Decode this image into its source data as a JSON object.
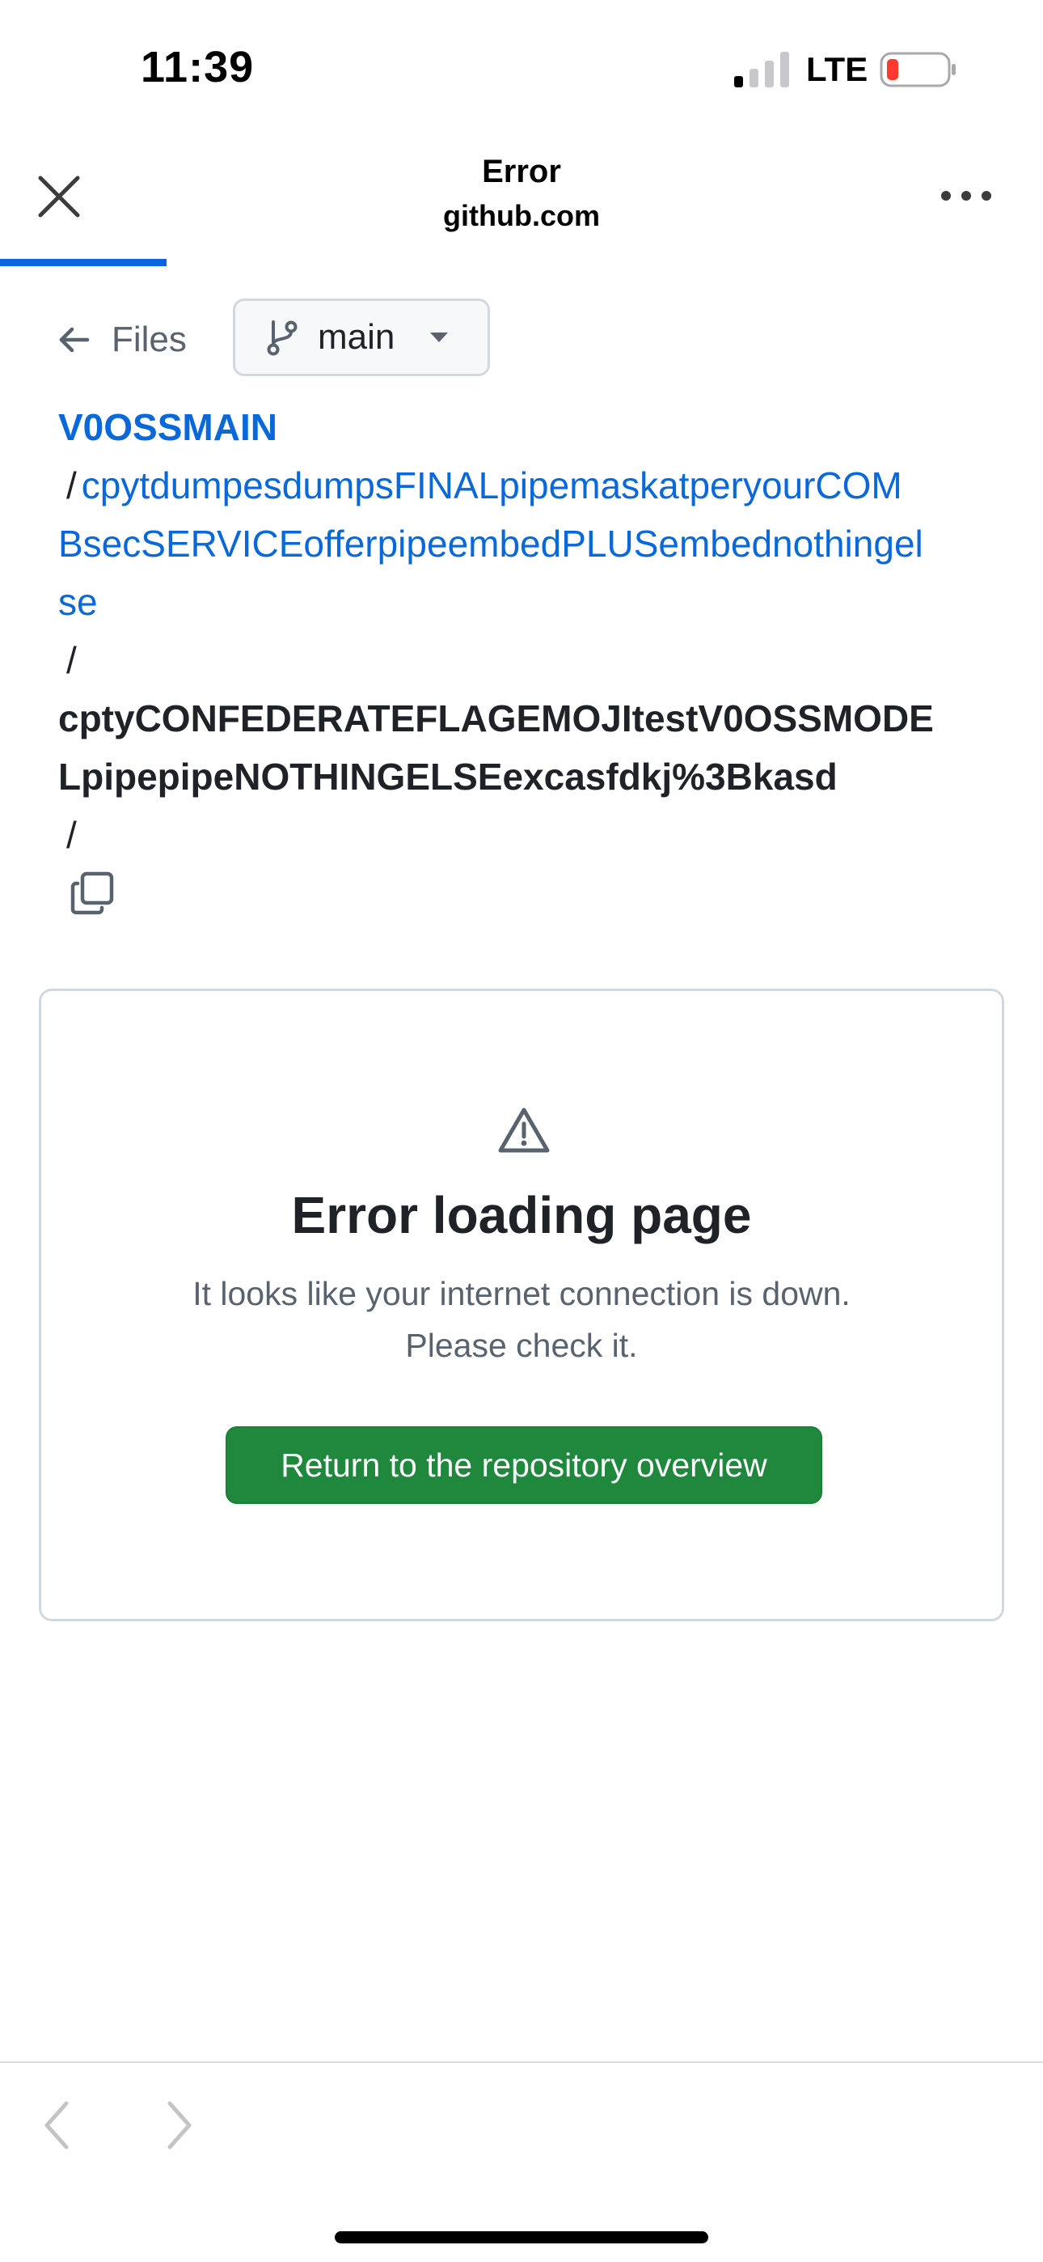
{
  "status_bar": {
    "time": "11:39",
    "network": "LTE",
    "battery_color": "#ff3b30"
  },
  "browser": {
    "title": "Error",
    "domain": "github.com",
    "close_icon": "close-icon",
    "more_icon": "more-horizontal-icon",
    "progress_fraction": 0.16,
    "accent": "#0a64e0"
  },
  "nav": {
    "files_label": "Files",
    "branch_label": "main"
  },
  "breadcrumb": {
    "repo": "V0OSSMAIN",
    "separator": "/",
    "folder_line1": "cpytdumpesdumpsFINALpipemaskatperyourCOM",
    "folder_line2": "BsecSERVICEofferpipeembedPLUSembednothingel",
    "folder_line3": "se",
    "current_line1": "cptyCONFEDERATEFLAGEMOJItestV0OSSMODE",
    "current_line2": "LpipepipeNOTHINGELSEexcasfdkj%3Bkasd"
  },
  "error_card": {
    "icon": "alert-icon",
    "title": "Error loading page",
    "message_line1": "It looks like your internet connection is down.",
    "message_line2": "Please check it.",
    "button_label": "Return to the repository overview",
    "button_color": "#1f883d"
  },
  "toolbar": {
    "back_icon": "chevron-left-icon",
    "forward_icon": "chevron-right-icon"
  }
}
